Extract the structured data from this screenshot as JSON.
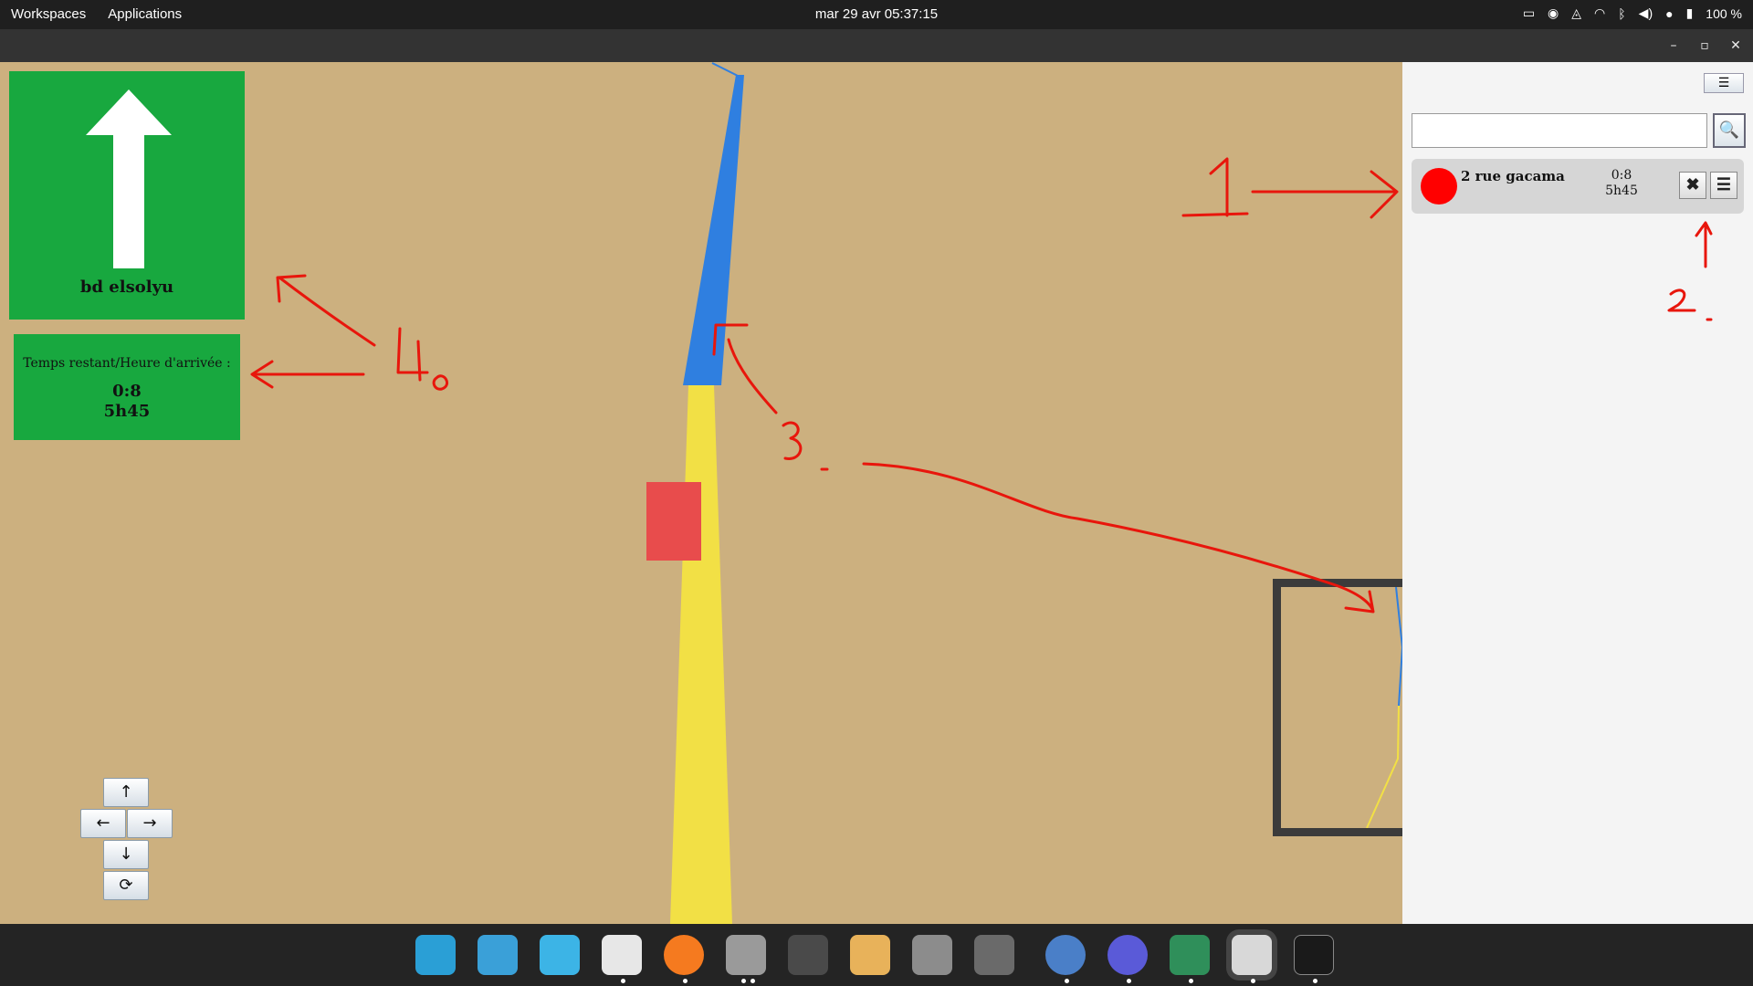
{
  "topbar": {
    "workspaces": "Workspaces",
    "applications": "Applications",
    "clock": "mar 29 avr  05:37:15",
    "battery": "100 %"
  },
  "window": {
    "minimize": "–",
    "maximize": "▫",
    "close": "✕"
  },
  "navigation": {
    "direction_icon": "arrow-up-icon",
    "street": "bd elsolyu",
    "time_label": "Temps restant/Heure d'arrivée :",
    "remaining": "0:8",
    "arrival": "5h45"
  },
  "controls": {
    "up": "↑",
    "left": "←",
    "right": "→",
    "down": "↓",
    "rotate": "⟳"
  },
  "minimap": {
    "fullscreen_icon": "⛶"
  },
  "sidebar": {
    "menu_icon": "☰",
    "search_value": "",
    "search_icon": "🔍",
    "destination": {
      "name": "2 rue gacama",
      "remaining": "0:8",
      "arrival": "5h45",
      "dot_color": "#ff0000",
      "remove_icon": "✖",
      "menu_icon": "☰"
    }
  },
  "annotations": {
    "n1": "1",
    "n2": "2.",
    "n3": "3.",
    "n4": "4."
  },
  "colors": {
    "map_background": "#ccb07f",
    "panel_green": "#18a83f",
    "route_blue": "#2f7fe0",
    "route_yellow": "#f2e045",
    "vehicle_red": "#e84c4c",
    "annotation_red": "#e8160c"
  }
}
